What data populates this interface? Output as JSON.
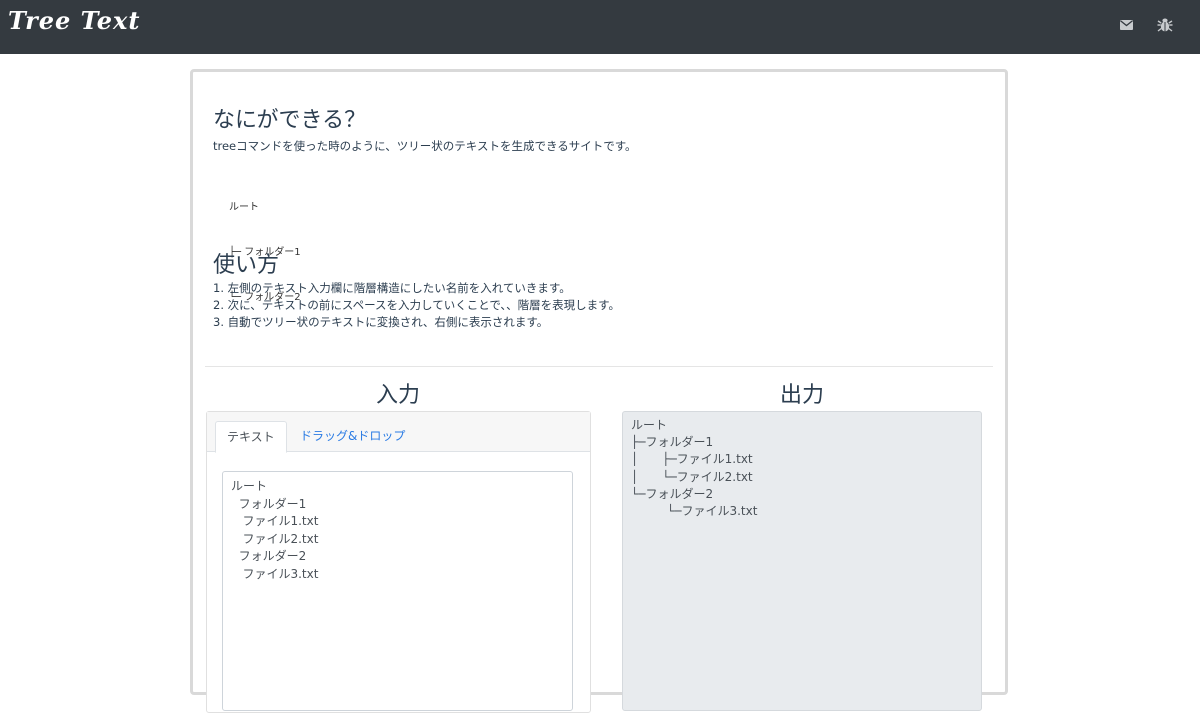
{
  "navbar": {
    "brand": "Tree Text",
    "icons": [
      "mail-icon",
      "bug-icon"
    ]
  },
  "about": {
    "title": "なにができる？",
    "description": "treeコマンドを使った時のように、ツリー状のテキストを生成できるサイトです。",
    "sample": [
      "ルート",
      "├─ フォルダー1",
      "└─ フォルダー2"
    ]
  },
  "usage": {
    "title": "使い方",
    "steps": [
      "1. 左側のテキスト入力欄に階層構造にしたい名前を入れていきます。",
      "2. 次に、テキストの前にスペースを入力していくことで、、階層を表現します。",
      "3. 自動でツリー状のテキストに変換され、右側に表示されます。"
    ]
  },
  "input": {
    "title": "入力",
    "tabs": [
      "テキスト",
      "ドラッグ&ドロップ"
    ],
    "text": "ルート\n  フォルダー1\n   ファイル1.txt\n   ファイル2.txt\n  フォルダー2\n   ファイル3.txt"
  },
  "output": {
    "title": "出力",
    "text": "ルート\n├─フォルダー1\n│　　├─ファイル1.txt\n│　　└─ファイル2.txt\n└─フォルダー2\n　　　└─ファイル3.txt"
  },
  "colors": {
    "navbar": "#343a40",
    "accent": "#2a7be4",
    "output_bg": "#e8ebee"
  }
}
